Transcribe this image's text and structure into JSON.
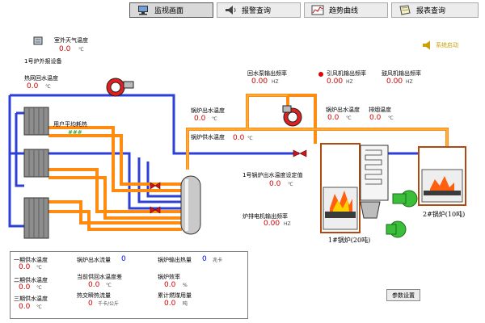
{
  "nav": {
    "tabs": [
      {
        "label": "监视画面",
        "icon": "monitor-icon",
        "active": true
      },
      {
        "label": "报警查询",
        "icon": "speaker-icon",
        "active": false
      },
      {
        "label": "趋势曲线",
        "icon": "chart-icon",
        "active": false
      },
      {
        "label": "报表查询",
        "icon": "document-icon",
        "active": false
      }
    ]
  },
  "outdoor": {
    "label": "室外天气温度",
    "value": "0.0",
    "unit": "℃"
  },
  "device_caption": "1号炉外报设备",
  "return_temp": {
    "label": "热网回水温度",
    "value": "0.0",
    "unit": "℃"
  },
  "user_avg": {
    "label": "用户平均耗热",
    "value": "###"
  },
  "outlet_temp": {
    "label": "锅炉出水温度",
    "value": "0.0",
    "unit": "℃"
  },
  "supply_temp": {
    "label": "锅炉供水温度",
    "value": "0.0",
    "unit": "℃"
  },
  "return_pump_freq": {
    "label": "回水泵输出频率",
    "value": "0.00",
    "unit": "HZ"
  },
  "fan_freq": {
    "label": "引风机输出频率",
    "value": "0.00",
    "unit": "HZ"
  },
  "blower_freq": {
    "label": "鼓风机输出频率",
    "value": "0.00",
    "unit": "HZ"
  },
  "outlet_temp2": {
    "label": "锅炉出水温度",
    "value": "0.0",
    "unit": "℃"
  },
  "exhaust_temp": {
    "label": "排烟温度",
    "value": "0.0",
    "unit": "℃"
  },
  "setpoint": {
    "label": "1号锅炉出水温度设定值",
    "value": "0.0",
    "unit": "℃"
  },
  "grate_freq": {
    "label": "炉排电机输出频率",
    "value": "0.00",
    "unit": "HZ"
  },
  "boiler1_caption": "1#锅炉(20吨)",
  "boiler2_caption": "2#锅炉(10吨)",
  "top_right_btn": "系统启动",
  "bottom_panel": {
    "rows": [
      {
        "label": "一期供水温度",
        "value": "0.0",
        "unit": "℃"
      },
      {
        "label": "二期供水温度",
        "value": "0.0",
        "unit": "℃"
      },
      {
        "label": "三期供水温度",
        "value": "0.0",
        "unit": "℃"
      }
    ],
    "mid": [
      {
        "label": "锅炉出水流量",
        "value": "0"
      },
      {
        "label": "当前供回水温度差",
        "value": "0.0",
        "unit": "℃"
      },
      {
        "label": "热交瞬热流量",
        "value": "0",
        "unit": "千卡/公斤"
      }
    ],
    "right": [
      {
        "label": "锅炉输出热量",
        "value": "0",
        "unit": "兆卡"
      },
      {
        "label": "锅炉效率",
        "value": "0.0",
        "unit": "%"
      },
      {
        "label": "累计燃煤用量",
        "value": "0.0",
        "unit": "吨"
      }
    ]
  },
  "param_btn": "参数设置"
}
